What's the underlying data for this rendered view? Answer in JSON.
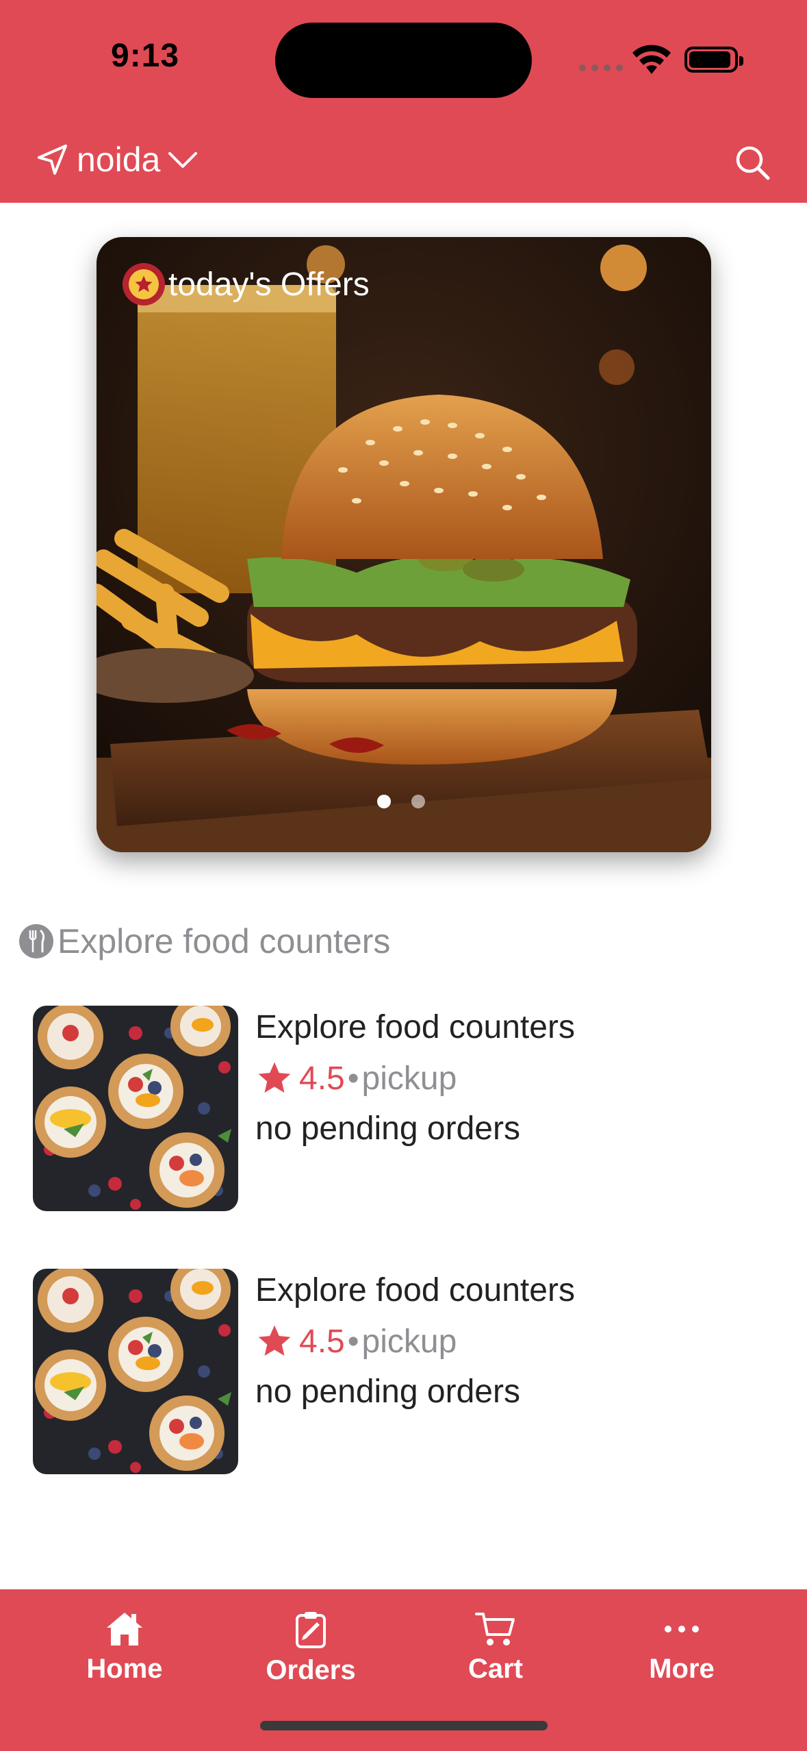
{
  "status_bar": {
    "time": "9:13"
  },
  "header": {
    "location": "noida",
    "icons": {
      "location": "navigation-arrow-icon",
      "dropdown": "chevron-down-icon",
      "search": "search-icon"
    }
  },
  "banner": {
    "title": "today's Offers",
    "badge_icon": "star-badge-icon",
    "image": "burger-with-fries-photo",
    "page_count": 2,
    "active_page": 1
  },
  "section": {
    "title": "Explore food counters",
    "icon": "fork-knife-icon"
  },
  "counters": [
    {
      "name": "Explore food counters",
      "rating": "4.5",
      "separator": "•",
      "mode": "pickup",
      "status": "no pending orders",
      "image": "fruit-tarts-photo"
    },
    {
      "name": "Explore food counters",
      "rating": "4.5",
      "separator": "•",
      "mode": "pickup",
      "status": "no pending orders",
      "image": "fruit-tarts-photo"
    }
  ],
  "tabbar": {
    "tabs": [
      {
        "label": "Home",
        "icon": "house-icon"
      },
      {
        "label": "Orders",
        "icon": "clipboard-icon"
      },
      {
        "label": "Cart",
        "icon": "cart-icon"
      },
      {
        "label": "More",
        "icon": "ellipsis-icon"
      }
    ]
  },
  "colors": {
    "brand": "#e04a55",
    "muted_text": "#8e8e93",
    "rating_star": "#e04a55"
  }
}
